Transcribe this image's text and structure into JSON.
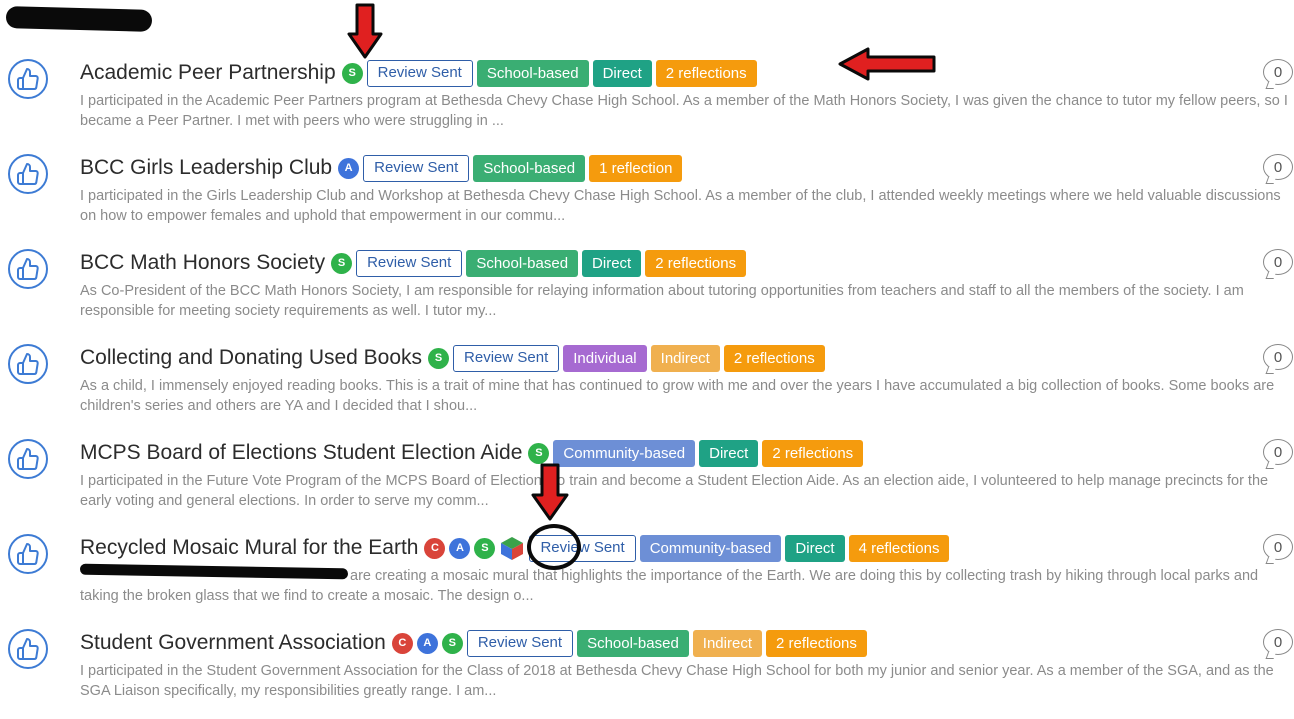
{
  "items": [
    {
      "title": "Academic Peer Partnership",
      "badges": [
        "S"
      ],
      "tags": [
        "Review Sent",
        "School-based",
        "Direct",
        "2 reflections"
      ],
      "description": "I participated in the Academic Peer Partners program at Bethesda Chevy Chase High School. As a member of the Math Honors Society, I was given the chance to tutor my fellow peers, so I became a Peer Partner. I met with peers who were struggling in ...",
      "count": "0"
    },
    {
      "title": "BCC Girls Leadership Club",
      "badges": [
        "A"
      ],
      "tags": [
        "Review Sent",
        "School-based",
        "1 reflection"
      ],
      "description": "I participated in the Girls Leadership Club and Workshop at Bethesda Chevy Chase High School. As a member of the club, I attended weekly meetings where we held valuable discussions on how to empower females and uphold that empowerment in our commu...",
      "count": "0"
    },
    {
      "title": "BCC Math Honors Society",
      "badges": [
        "S"
      ],
      "tags": [
        "Review Sent",
        "School-based",
        "Direct",
        "2 reflections"
      ],
      "description": "As Co-President of the BCC Math Honors Society, I am responsible for relaying information about tutoring opportunities from teachers and staff to all the members of the society. I am responsible for meeting society requirements as well. I tutor my...",
      "count": "0"
    },
    {
      "title": "Collecting and Donating Used Books",
      "badges": [
        "S"
      ],
      "tags": [
        "Review Sent",
        "Individual",
        "Indirect",
        "2 reflections"
      ],
      "description": "As a child, I immensely enjoyed reading books. This is a trait of mine that has continued to grow with me and over the years I have accumulated a big collection of books. Some books are children's series and others are YA and I decided that I shou...",
      "count": "0"
    },
    {
      "title": "MCPS Board of Elections Student Election Aide",
      "badges": [
        "S"
      ],
      "tags": [
        "Community-based",
        "Direct",
        "2 reflections"
      ],
      "description": "I participated in the Future Vote Program of the MCPS Board of Elections to train and become a Student Election Aide. As an election aide, I volunteered to help manage precincts for the early voting and general elections. In order to serve my comm...",
      "count": "0"
    },
    {
      "title": "Recycled Mosaic Mural for the Earth",
      "badges": [
        "C",
        "A",
        "S"
      ],
      "tags": [
        "Review Sent",
        "Community-based",
        "Direct",
        "4 reflections"
      ],
      "description": "are creating a mosaic mural that highlights the importance of the Earth. We are doing this by collecting trash by hiking through local parks and taking the broken glass that we find to create a mosaic. The design o...",
      "count": "0"
    },
    {
      "title": "Student Government Association",
      "badges": [
        "C",
        "A",
        "S"
      ],
      "tags": [
        "Review Sent",
        "School-based",
        "Indirect",
        "2 reflections"
      ],
      "description": "I participated in the Student Government Association for the Class of 2018 at Bethesda Chevy Chase High School for both my junior and senior year. As a member of the SGA, and as the SGA Liaison specifically, my responsibilities greatly range. I am...",
      "count": "0"
    }
  ],
  "colors": {
    "like_blue": "#3d7bd4",
    "badge_C": "#d9443a",
    "badge_A": "#3e73db",
    "badge_S": "#2fb24a",
    "Review Sent": "#2f5ea8",
    "School-based": "#3aae73",
    "Direct": "#1fa285",
    "reflections": "#f59b0d",
    "Individual": "#a66ad1",
    "Indirect": "#f0b04f",
    "Community-based": "#6d8fd6",
    "annotation_arrow": "#e02020"
  },
  "icons": {
    "like": "thumbs-up-icon",
    "comment": "comment-bubble-icon",
    "cube": "colored-cube-icon",
    "annotation": "red-arrow-icon"
  }
}
